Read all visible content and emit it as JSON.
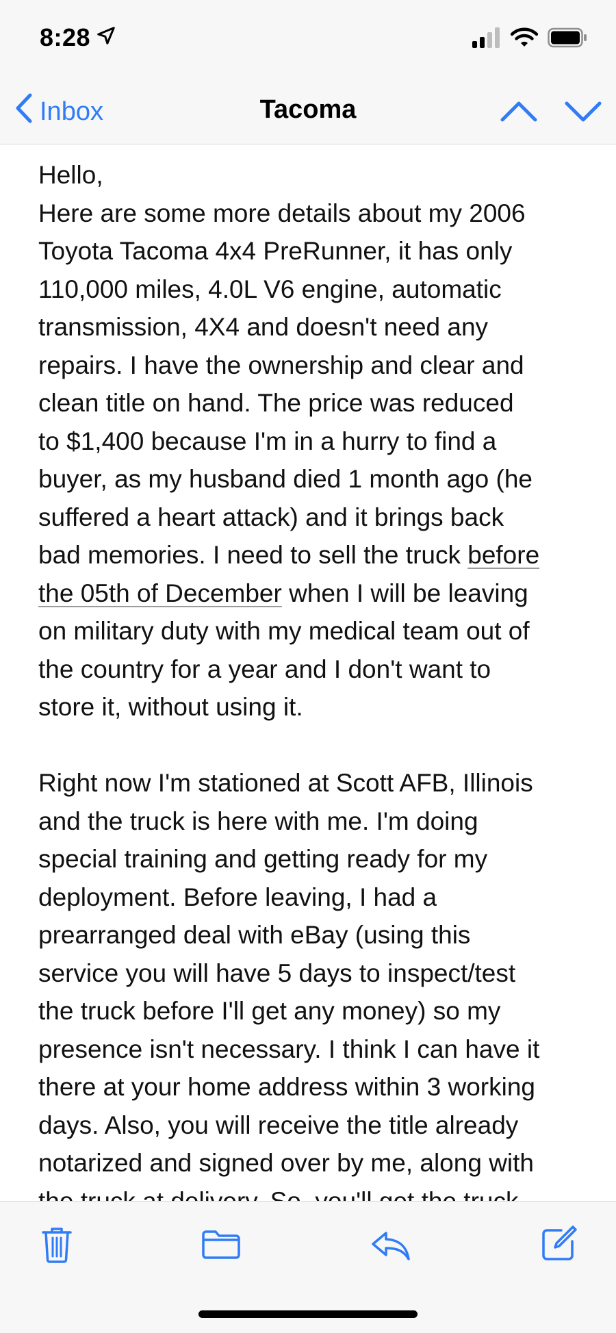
{
  "status_bar": {
    "time": "8:28",
    "icons": [
      "location-arrow-icon",
      "cellular-signal-icon",
      "wifi-icon",
      "battery-icon"
    ]
  },
  "nav": {
    "back_label": "Inbox",
    "title": "Tacoma",
    "accent_color": "#2f7cf6"
  },
  "email": {
    "greeting": "Hello,",
    "p1_before": " Here are some  more details about my 2006\nToyota Tacoma 4x4 PreRunner, it has only\n110,000  miles, 4.0L V6 engine, automatic\ntransmission, 4X4 and doesn't need any\nrepairs. I have the ownership and clear and\nclean title on hand. The  price was reduced\nto $1,400 because I'm in a hurry to find a\nbuyer, as  my husband died 1 month ago (he\nsuffered a heart attack) and it brings  back\nbad memories. I need to sell the truck ",
    "p1_link_a": "before",
    "p1_link_b": "the 05th of December",
    "p1_after": " when I will be leaving\non military duty with my medical team out of\nthe country for a year and I don't want to\nstore it, without using it.",
    "p2": "Right  now I'm stationed at Scott AFB, Illinois\nand the truck is here with me. I'm doing\nspecial training and getting ready for my\ndeployment. Before leaving, I had a\nprearranged deal with eBay (using this\nservice you will have 5 days to inspect/test\nthe truck before I'll get any money) so my\npresence isn't necessary. I think I can have it\nthere at your home address within 3 working\ndays. Also, you will receive the title already\nnotarized and signed over by me, along with\nthe truck at delivery. So, you'll get the truck"
  },
  "toolbar": {
    "icons": [
      "trash-icon",
      "folder-icon",
      "reply-icon",
      "compose-icon"
    ]
  }
}
